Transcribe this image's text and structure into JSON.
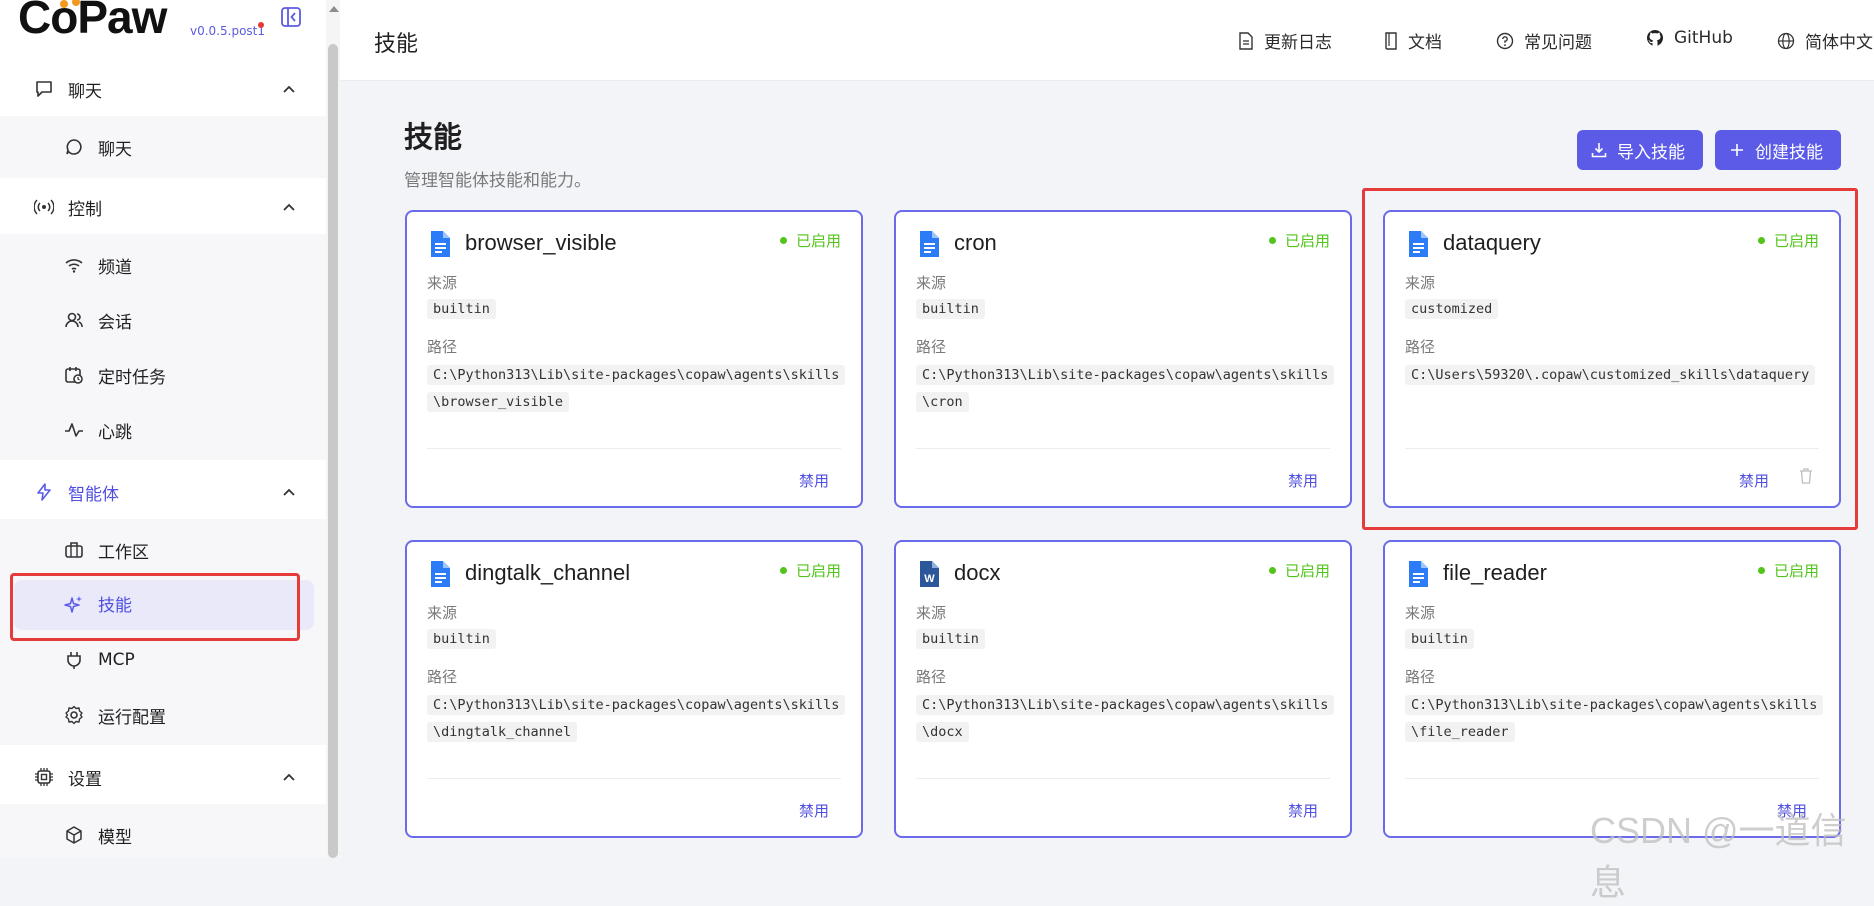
{
  "app": {
    "logo": "CoPaw",
    "version": "v0.0.5.post1"
  },
  "sidebar": {
    "groups": [
      {
        "label": "聊天",
        "items": [
          {
            "label": "聊天"
          }
        ]
      },
      {
        "label": "控制",
        "items": [
          {
            "label": "频道"
          },
          {
            "label": "会话"
          },
          {
            "label": "定时任务"
          },
          {
            "label": "心跳"
          }
        ]
      },
      {
        "label": "智能体",
        "items": [
          {
            "label": "工作区"
          },
          {
            "label": "技能"
          },
          {
            "label": "MCP"
          },
          {
            "label": "运行配置"
          }
        ]
      },
      {
        "label": "设置",
        "items": [
          {
            "label": "模型"
          }
        ]
      }
    ],
    "active_item": "技能"
  },
  "header": {
    "title": "技能",
    "links": [
      {
        "label": "更新日志"
      },
      {
        "label": "文档"
      },
      {
        "label": "常见问题"
      },
      {
        "label": "GitHub"
      },
      {
        "label": "简体中文"
      }
    ]
  },
  "page": {
    "title": "技能",
    "subtitle": "管理智能体技能和能力。",
    "import_label": "导入技能",
    "create_label": "创建技能"
  },
  "card_labels": {
    "source": "来源",
    "path": "路径",
    "disable": "禁用",
    "status": "已启用"
  },
  "skills": [
    {
      "name": "browser_visible",
      "status": "已启用",
      "source": "builtin",
      "path_line1": "C:\\Python313\\Lib\\site-packages\\copaw\\agents\\skills",
      "path_line2": "\\browser_visible",
      "icon": "file-doc-icon"
    },
    {
      "name": "cron",
      "status": "已启用",
      "source": "builtin",
      "path_line1": "C:\\Python313\\Lib\\site-packages\\copaw\\agents\\skills",
      "path_line2": "\\cron",
      "icon": "file-doc-icon"
    },
    {
      "name": "dataquery",
      "status": "已启用",
      "source": "customized",
      "path_line1": "C:\\Users\\59320\\.copaw\\customized_skills\\dataquery",
      "path_line2": "",
      "icon": "file-doc-icon"
    },
    {
      "name": "dingtalk_channel",
      "status": "已启用",
      "source": "builtin",
      "path_line1": "C:\\Python313\\Lib\\site-packages\\copaw\\agents\\skills",
      "path_line2": "\\dingtalk_channel",
      "icon": "file-doc-icon"
    },
    {
      "name": "docx",
      "status": "已启用",
      "source": "builtin",
      "path_line1": "C:\\Python313\\Lib\\site-packages\\copaw\\agents\\skills",
      "path_line2": "\\docx",
      "icon": "word-doc-icon"
    },
    {
      "name": "file_reader",
      "status": "已启用",
      "source": "builtin",
      "path_line1": "C:\\Python313\\Lib\\site-packages\\copaw\\agents\\skills",
      "path_line2": "\\file_reader",
      "icon": "file-doc-icon"
    }
  ],
  "watermark": "CSDN @一道信息",
  "colors": {
    "accent": "#5b5be8",
    "enabled": "#52c41a",
    "highlight": "#e63b3b"
  }
}
